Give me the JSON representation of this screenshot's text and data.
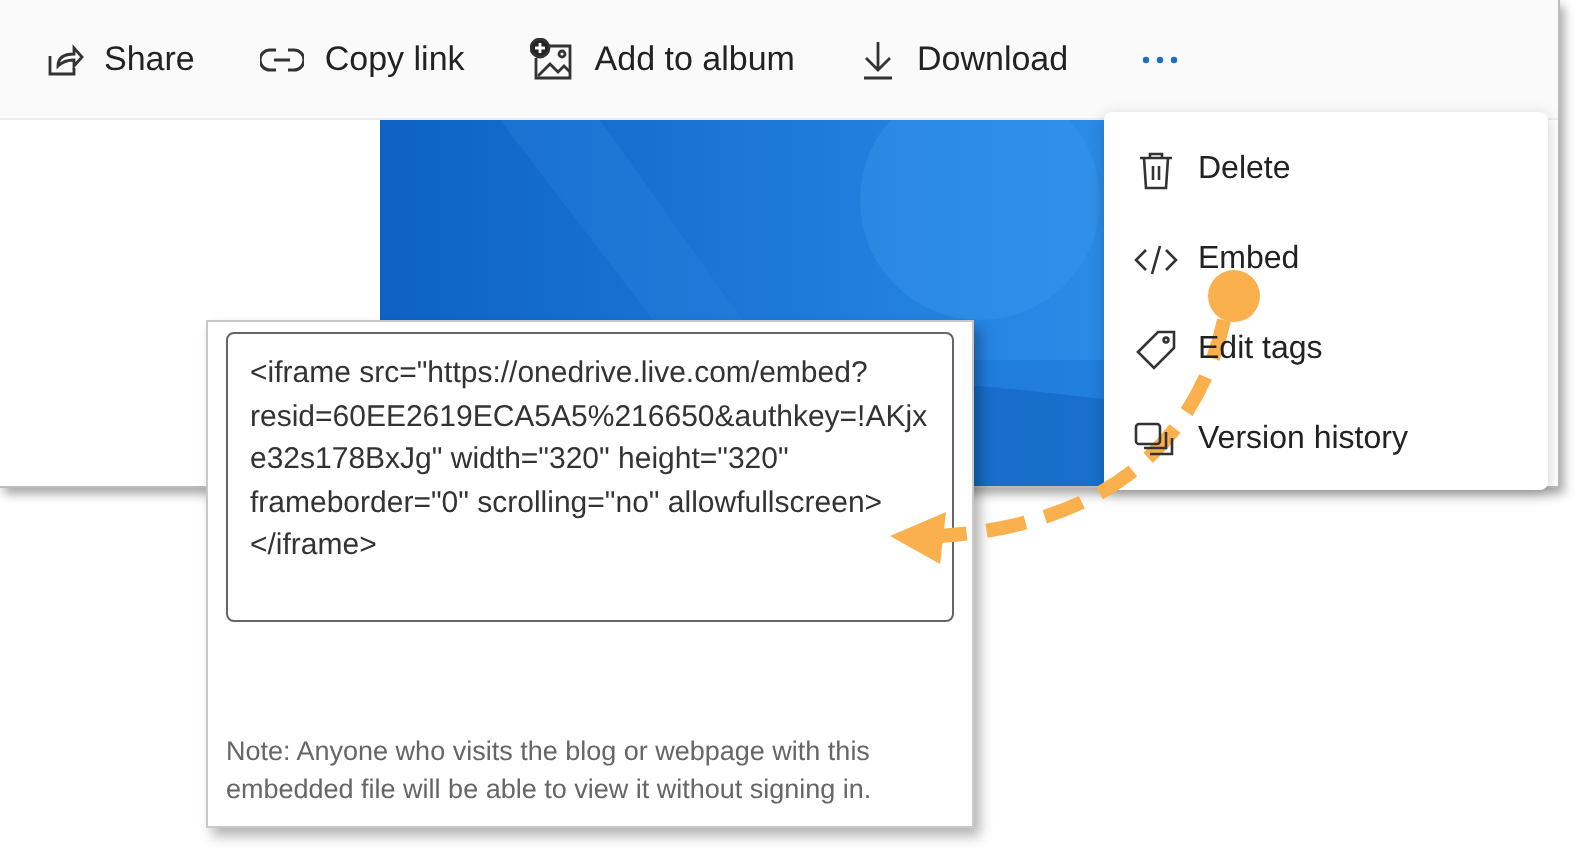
{
  "toolbar": {
    "actions": [
      {
        "label": "Share"
      },
      {
        "label": "Copy link"
      },
      {
        "label": "Add to album"
      },
      {
        "label": "Download"
      }
    ]
  },
  "menu": {
    "items": [
      {
        "label": "Delete"
      },
      {
        "label": "Embed"
      },
      {
        "label": "Edit tags"
      },
      {
        "label": "Version history"
      }
    ]
  },
  "embed_panel": {
    "code": "<iframe src=\"https://onedrive.live.com/embed?resid=60EE2619ECA5A5%216650&authkey=!AKjxe32s178BxJg\" width=\"320\" height=\"320\" frameborder=\"0\" scrolling=\"no\" allowfullscreen></iframe>",
    "note": "Note: Anyone who visits the blog or webpage with this embedded file will be able to view it without signing in."
  }
}
